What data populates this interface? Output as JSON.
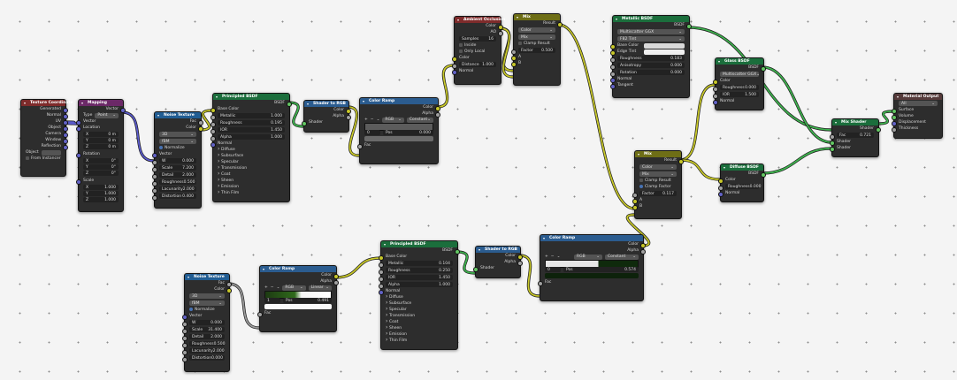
{
  "colors": {
    "shader": "#1b6e3c",
    "texture": "#7a4d13",
    "converter": "#2b5c8f",
    "vector": "#6b2967",
    "input": "#7e2b2b",
    "color": "#6e6e16"
  },
  "texcoord": {
    "title": "Texture Coordinate",
    "outputs": [
      "Generated",
      "Normal",
      "UV",
      "Object",
      "Camera",
      "Window",
      "Reflection"
    ],
    "object_label": "Object",
    "from_instancer": "From Instancer"
  },
  "mapping": {
    "title": "Mapping",
    "vector_out": "Vector",
    "type_label": "Type",
    "type_value": "Point",
    "vector_in": "Vector",
    "location": "Location",
    "loc": [
      [
        "X",
        "0 m"
      ],
      [
        "Y",
        "0 m"
      ],
      [
        "Z",
        "0 m"
      ]
    ],
    "rotation": "Rotation",
    "rot": [
      [
        "X",
        "0°"
      ],
      [
        "Y",
        "0°"
      ],
      [
        "Z",
        "0°"
      ]
    ],
    "scale": "Scale",
    "scl": [
      [
        "X",
        "1.000"
      ],
      [
        "Y",
        "1.000"
      ],
      [
        "Z",
        "1.000"
      ]
    ]
  },
  "noise1": {
    "title": "Noise Texture",
    "fac": "Fac",
    "color": "Color",
    "dim": "3D",
    "type": "fBM",
    "normalize": "Normalize",
    "vector": "Vector",
    "fields": [
      [
        "W",
        "0.000"
      ],
      [
        "Scale",
        "7.200"
      ],
      [
        "Detail",
        "2.000"
      ],
      [
        "Roughness",
        "0.500"
      ],
      [
        "Lacunarity",
        "2.000"
      ],
      [
        "Distortion",
        "0.400"
      ]
    ]
  },
  "pbsdf1": {
    "title": "Principled BSDF",
    "bsdf": "BSDF",
    "base_color": "Base Color",
    "fields": [
      [
        "Metallic",
        "1.000"
      ],
      [
        "Roughness",
        "0.195"
      ],
      [
        "IOR",
        "1.450"
      ],
      [
        "Alpha",
        "1.000"
      ]
    ],
    "normal": "Normal",
    "subs": [
      "Diffuse",
      "Subsurface",
      "Specular",
      "Transmission",
      "Coat",
      "Sheen",
      "Emission",
      "Thin Film"
    ]
  },
  "s2rgb1": {
    "title": "Shader to RGB",
    "color": "Color",
    "alpha": "Alpha",
    "shader": "Shader"
  },
  "ramp1": {
    "title": "Color Ramp",
    "color": "Color",
    "alpha": "Alpha",
    "mode": "RGB",
    "interp": "Constant",
    "idx": "0",
    "pos_label": "Pos",
    "pos": "0.000",
    "fac": "Fac"
  },
  "ao": {
    "title": "Ambient Occlusion",
    "color": "Color",
    "ao": "AO",
    "samples_label": "Samples",
    "samples": "16",
    "inside": "Inside",
    "only_local": "Only Local",
    "color_in": "Color",
    "distance_label": "Distance",
    "distance": "1.000",
    "normal": "Normal"
  },
  "mix1": {
    "title": "Mix",
    "result": "Result",
    "dtype": "Color",
    "blend": "Mix",
    "clamp": "Clamp Result",
    "factor_label": "Factor",
    "factor": "0.500",
    "a": "A",
    "b": "B"
  },
  "metallic": {
    "title": "Metallic BSDF",
    "bsdf": "BSDF",
    "dist": "Multiscatter GGX",
    "fresnel": "F82 Tint",
    "base_color": "Base Color",
    "edge_tint": "Edge Tint",
    "fields": [
      [
        "Roughness",
        "0.183"
      ],
      [
        "Anisotropy",
        "0.000"
      ],
      [
        "Rotation",
        "0.000"
      ]
    ],
    "normal": "Normal",
    "tangent": "Tangent"
  },
  "glass": {
    "title": "Glass BSDF",
    "bsdf": "BSDF",
    "dist": "Multiscatter GGX",
    "color": "Color",
    "fields": [
      [
        "Roughness",
        "0.000"
      ],
      [
        "IOR",
        "1.500"
      ]
    ],
    "normal": "Normal"
  },
  "mix2": {
    "title": "Mix",
    "result": "Result",
    "dtype": "Color",
    "blend": "Mix",
    "clamp": "Clamp Result",
    "clamp_factor": "Clamp Factor",
    "factor_label": "Factor",
    "factor": "0.117",
    "a": "A",
    "b": "B"
  },
  "diffuse": {
    "title": "Diffuse BSDF",
    "bsdf": "BSDF",
    "color": "Color",
    "roughness_label": "Roughness",
    "roughness": "0.000",
    "normal": "Normal"
  },
  "mixshader": {
    "title": "Mix Shader",
    "shader": "Shader",
    "fac_label": "Fac",
    "fac": "0.721"
  },
  "output": {
    "title": "Material Output",
    "target": "All",
    "surface": "Surface",
    "volume": "Volume",
    "displacement": "Displacement",
    "thickness": "Thickness"
  },
  "noise2": {
    "title": "Noise Texture",
    "fac": "Fac",
    "color": "Color",
    "dim": "3D",
    "type": "fBM",
    "normalize": "Normalize",
    "vector": "Vector",
    "fields": [
      [
        "W",
        "0.000"
      ],
      [
        "Scale",
        "31.400"
      ],
      [
        "Detail",
        "2.000"
      ],
      [
        "Roughness",
        "0.500"
      ],
      [
        "Lacunarity",
        "2.000"
      ],
      [
        "Distortion",
        "0.000"
      ]
    ]
  },
  "ramp2": {
    "title": "Color Ramp",
    "color": "Color",
    "alpha": "Alpha",
    "mode": "RGB",
    "interp": "Linear",
    "idx": "1",
    "pos_label": "Pos",
    "pos": "0.491",
    "fac": "Fac"
  },
  "pbsdf2": {
    "title": "Principled BSDF",
    "bsdf": "BSDF",
    "base_color": "Base Color",
    "fields": [
      [
        "Metallic",
        "0.104"
      ],
      [
        "Roughness",
        "0.250"
      ],
      [
        "IOR",
        "1.450"
      ],
      [
        "Alpha",
        "1.000"
      ]
    ],
    "normal": "Normal",
    "subs": [
      "Diffuse",
      "Subsurface",
      "Specular",
      "Transmission",
      "Coat",
      "Sheen",
      "Emission",
      "Thin Film"
    ]
  },
  "s2rgb2": {
    "title": "Shader to RGB",
    "color": "Color",
    "alpha": "Alpha",
    "shader": "Shader"
  },
  "ramp3": {
    "title": "Color Ramp",
    "color": "Color",
    "alpha": "Alpha",
    "mode": "RGB",
    "interp": "Constant",
    "idx": "0",
    "pos_label": "Pos",
    "pos": "0.574",
    "fac": "Fac"
  }
}
